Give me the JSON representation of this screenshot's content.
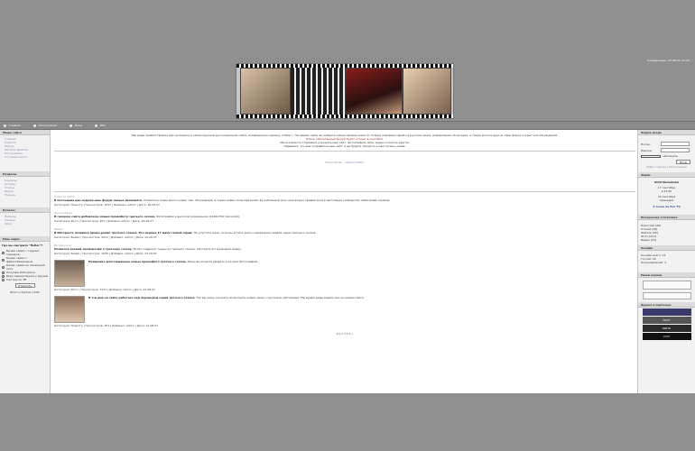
{
  "header": {
    "datetime": "Понедельник, 27.08.07, 01:24"
  },
  "nav": {
    "items": [
      {
        "label": "Главная"
      },
      {
        "label": "Регистрация"
      },
      {
        "label": "Вход"
      },
      {
        "label": "RSS"
      }
    ]
  },
  "left": {
    "menu_title": "Меню сайта",
    "menu_items": [
      "Главная",
      "Новости",
      "Форум",
      "Каталог файлов",
      "Фотоальбом",
      "Гостевая книга"
    ],
    "section2_title": "Разделы",
    "section2_items": [
      "Сериалы",
      "Актеры",
      "Статьи",
      "Видео",
      "Музыка"
    ],
    "section3_title": "Каталог",
    "section3_items": [
      "Фильмы",
      "Сезоны",
      "Обои"
    ],
    "poll_title": "Наш опрос",
    "poll_question": "Где вы смотрите \"Побег\"?",
    "poll_options": [
      "Качаю серии с торрент-трекеров",
      "Качаю серии с файлообменников",
      "Качаю серии из локальной сети",
      "Покупаю DVD диски",
      "Беру переписанное у друзей",
      "Смотрю по ТВ"
    ],
    "poll_button": "Ответить",
    "poll_total": "Всего ответов: 1035"
  },
  "main": {
    "welcome_lines": [
      "Мы рады приветствовать вас на первом и самом крупном русскоязычном сайте, посвященном сериалу «Побег». На нашем сайте вы найдете самые свежие новости, полное описание серий на русском языке, информацию об актерах, а также многое другое. Наш форум открыт для обсуждений.",
      "Новое: обновленный форум будет открыт в сентябре.",
      "Мы все вместе стараемся улучшать наш сайт, фотографии, обои, видео и многое другое.",
      "Надеемся, что вам понравится наш сайт, и вы будете заходить к нам снова и снова."
    ],
    "banner_alt": "Prison Break - сериал Побег",
    "news": [
      {
        "category": "Новости сайта",
        "title": "В последние две недели наш форум сильно изменился.",
        "body": "Появилось очень много новых тем, обсуждений, а также новых пользователей. За небольшой срок наш форум превратился в настоящее сообщество любителей сериала.",
        "meta": "Категория: Новости | Просмотров: 1397 | Добавил: admin | Дата: 26.08.07"
      },
      {
        "category": "Фотографии",
        "title": "В галерею сайта добавлены новые промофото третьего сезона.",
        "body": "Фотографии в высоком разрешении (1100x750 пикселей).",
        "meta": "Категория: Фото | Просмотров: 401 | Добавил: admin | Дата: 25.08.07"
      },
      {
        "category": "Видео",
        "title": "В Интернете появился промо-ролик третьего сезона. Это первые 17 минут новой серии.",
        "body": "Не упустите шанс, если вы хотите знать содержание первой серии третьего сезона.",
        "meta": "Категория: Видео | Просмотров: 2011 | Добавил: admin | Дата: 24.08.07"
      },
      {
        "category": "Интересное",
        "title": "Появился первый проморолик к третьему сезону.",
        "body": "Ролик содержит сцены из третьего сезона. Смотрите его в разделе видео.",
        "meta": "Категория: Видео | Просмотров: 1045 | Добавил: admin | Дата: 23.08.07"
      },
      {
        "category": "",
        "title": "Появились долгожданные новые промофото третьего сезона.",
        "body": "Ниже вы можете увидеть 4 из этих фотографий.",
        "meta": "Категория: Фото | Просмотров: 7231 | Добавил: admin | Дата: 22.08.07"
      },
      {
        "category": "",
        "title": "В эти дни на сайте работает над переводом серий третьего сезона.",
        "body": "Так вы сразу сможете посмотреть новые серии с русскими субтитрами. Мы будем рады видеть вас на нашем сайте.",
        "meta": "Категория: Новости | Просмотров: 951 | Добавил: admin | Дата: 21.08.07"
      }
    ],
    "pager": "[1] 2 3 4 5 »"
  },
  "right": {
    "login_title": "Форма входа",
    "login_label": "Логин:",
    "password_label": "Пароль:",
    "remember_label": "запомнить",
    "login_button": "Вход",
    "forgot_link": "Забыл пароль | Регистрация",
    "countdown_title": "Ждём",
    "countdown_heading": "Until Showdown",
    "countdown_lines": [
      "17 сентября",
      "в 21:00",
      "24 сентября",
      "премьера"
    ],
    "countdown_footer": "3 сезон на Fox TV",
    "stats_title": "Интересная статистика",
    "stats_rows": [
      "Новостей [40]",
      "Статей [18]",
      "Файлов [26]",
      "Фото [411]",
      "Видео [15]"
    ],
    "online_title": "Онлайн",
    "online_rows": [
      "Онлайн всего: 23",
      "Гостей: 20",
      "Пользователей: 3"
    ],
    "friends_title": "Наши кнопки",
    "partners_title": "Друзья и партнеры",
    "partner_labels": [
      "ЛОСТ",
      "КИНО",
      "LOST"
    ]
  }
}
